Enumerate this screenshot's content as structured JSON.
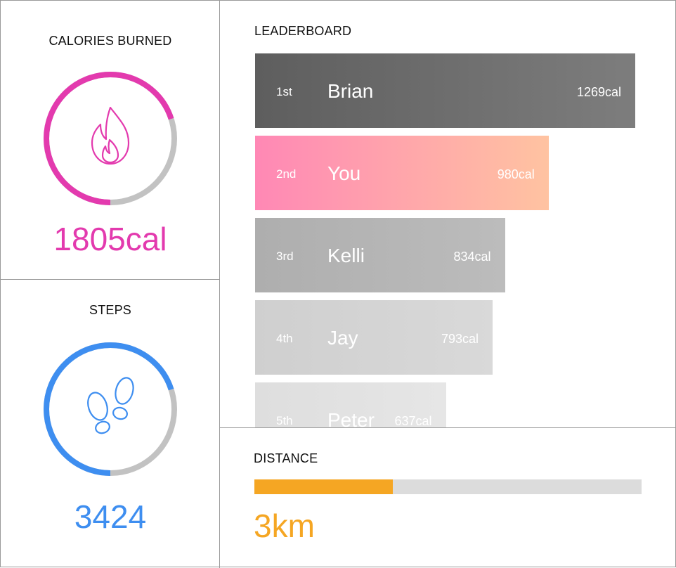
{
  "colors": {
    "calories": "#e33aae",
    "steps": "#3e8ef0",
    "distance": "#f5a623",
    "ring_track": "#c2c2c2",
    "distance_track": "#dcdcdc"
  },
  "calories": {
    "title": "CALORIES BURNED",
    "value": "1805cal",
    "progress": 0.7,
    "icon": "flame-icon"
  },
  "steps": {
    "title": "STEPS",
    "value": "3424",
    "progress": 0.7,
    "icon": "footprints-icon"
  },
  "leaderboard": {
    "title": "LEADERBOARD",
    "rows": [
      {
        "rank": "1st",
        "name": "Brian",
        "value": "1269cal",
        "cal": 1269,
        "gradient": [
          "#5e5e5e",
          "#7d7d7d"
        ]
      },
      {
        "rank": "2nd",
        "name": "You",
        "value": "980cal",
        "cal": 980,
        "gradient": [
          "#ff88b5",
          "#ffc3a1"
        ]
      },
      {
        "rank": "3rd",
        "name": "Kelli",
        "value": "834cal",
        "cal": 834,
        "gradient": [
          "#aeaeae",
          "#bcbcbc"
        ]
      },
      {
        "rank": "4th",
        "name": "Jay",
        "value": "793cal",
        "cal": 793,
        "gradient": [
          "#cfcfcf",
          "#d9d9d9"
        ]
      },
      {
        "rank": "5th",
        "name": "Peter",
        "value": "637cal",
        "cal": 637,
        "gradient": [
          "#dedede",
          "#e6e6e6"
        ]
      }
    ]
  },
  "distance": {
    "title": "DISTANCE",
    "value": "3km",
    "progress": 0.357
  }
}
